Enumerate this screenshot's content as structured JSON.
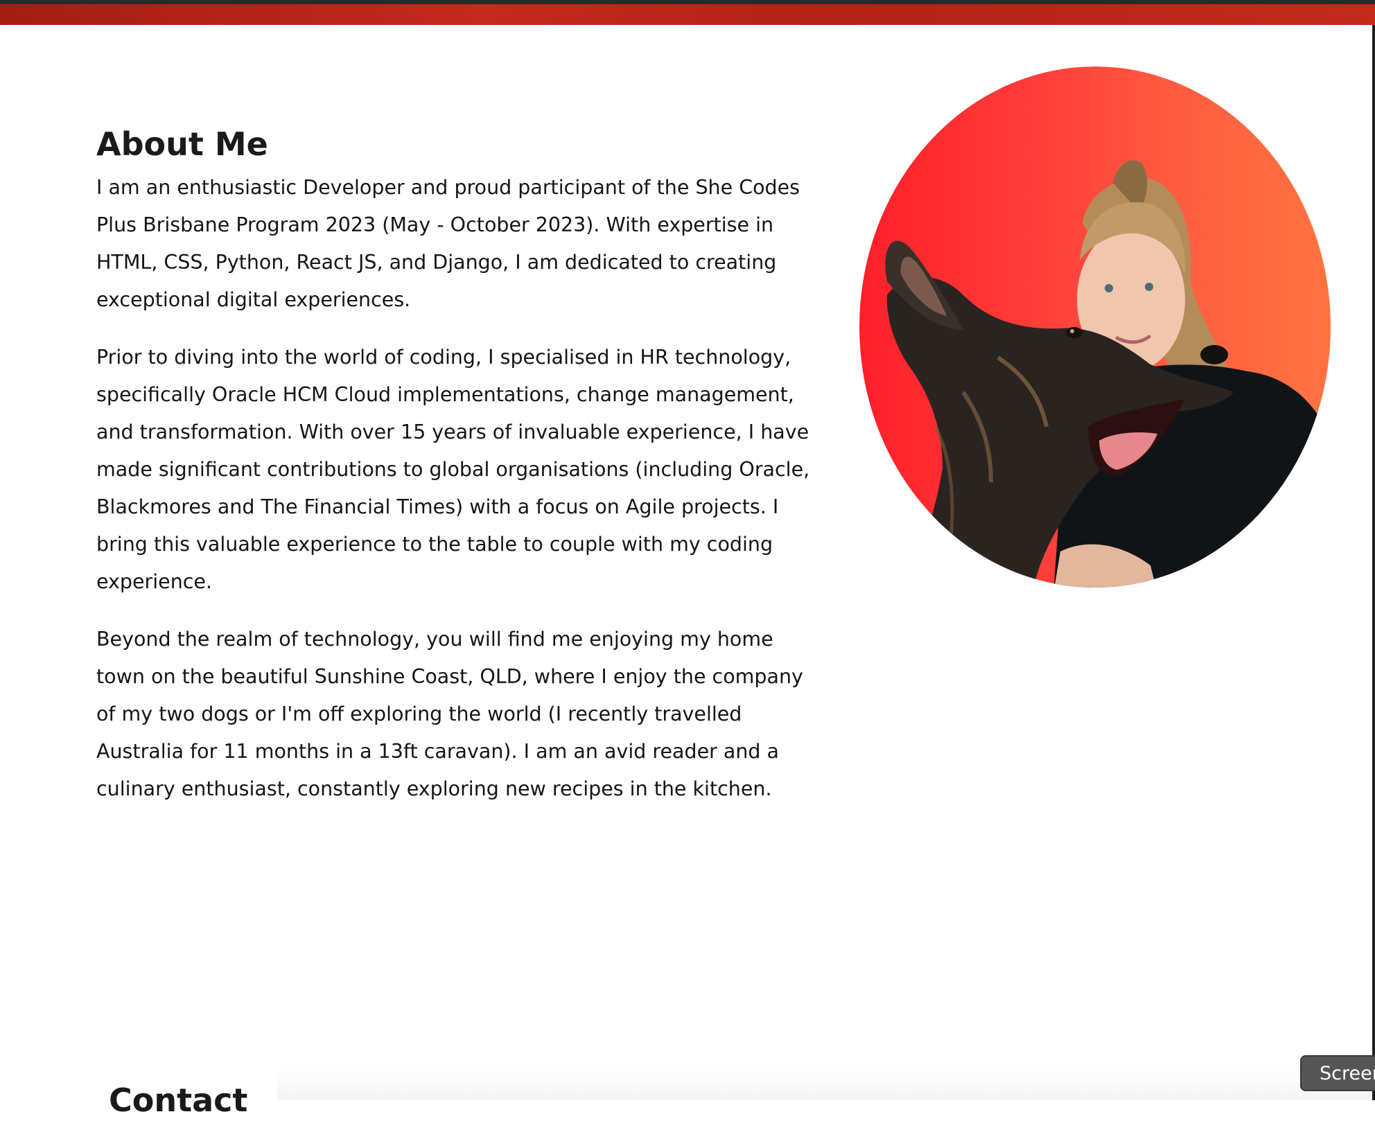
{
  "about": {
    "title": "About Me",
    "paragraphs": [
      "I am an enthusiastic Developer and proud participant of the She Codes Plus Brisbane Program 2023 (May - October 2023). With expertise in HTML, CSS, Python, React JS, and Django, I am dedicated to creating exceptional digital experiences.",
      "Prior to diving into the world of coding, I specialised in HR technology, specifically Oracle HCM Cloud implementations, change management, and transformation. With over 15 years of invaluable experience, I have made significant contributions to global organisations (including Oracle, Blackmores and The Financial Times) with a focus on Agile projects. I bring this valuable experience to the table to couple with my coding experience.",
      "Beyond the realm of technology, you will find me enjoying my home town on the beautiful Sunshine Coast, QLD, where I enjoy the company of my two dogs or I'm off exploring the world (I recently travelled Australia for 11 months in a 13ft caravan). I am an avid reader and a culinary enthusiast, constantly exploring new recipes in the kitchen."
    ]
  },
  "contact": {
    "title": "Contact"
  },
  "screen_button": {
    "label": "Screen"
  },
  "colors": {
    "banner": "#b32316",
    "photo_gradient_start": "#ff1f2a",
    "photo_gradient_end": "#ff7340"
  }
}
